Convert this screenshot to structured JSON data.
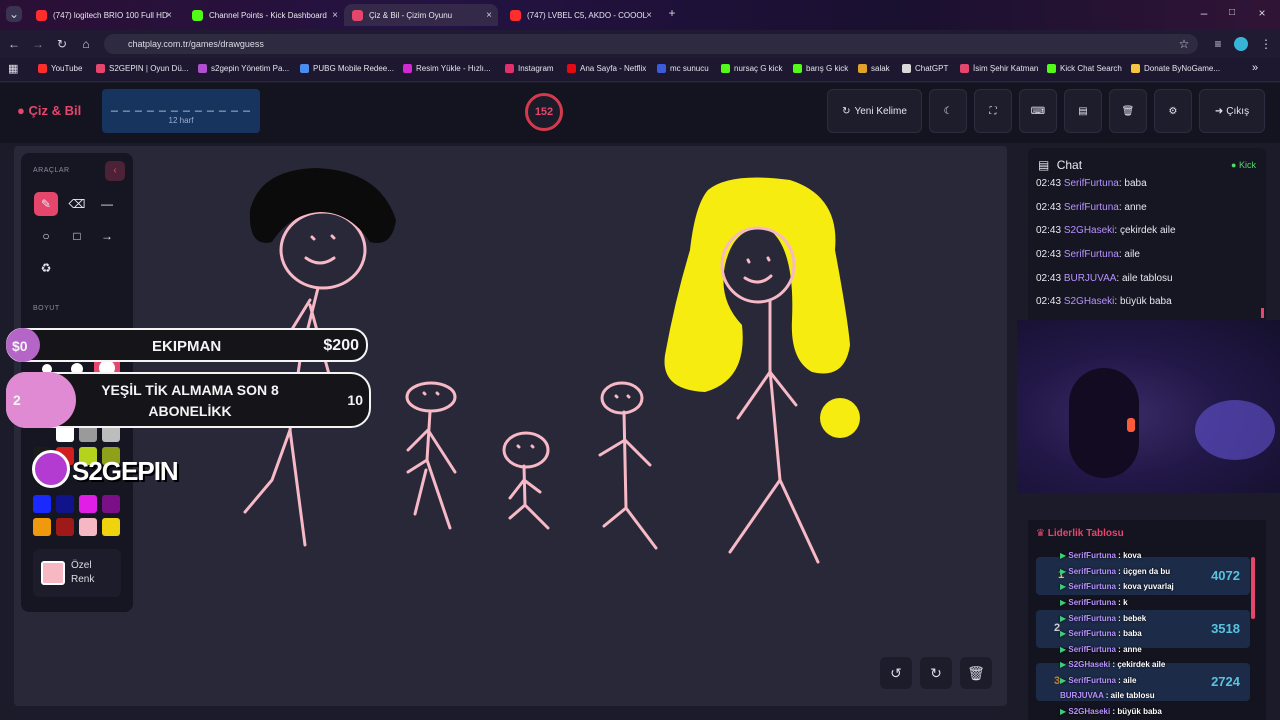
{
  "browser": {
    "tabs": [
      {
        "title": "(747) logitech BRIO 100 Full HD",
        "icon_color": "#ff2d2d"
      },
      {
        "title": "Channel Points - Kick Dashboard",
        "icon_color": "#53fc18"
      },
      {
        "title": "Çiz & Bil - Çizim Oyunu",
        "icon_color": "#e5466b"
      },
      {
        "title": "(747) LVBEL C5, AKDO - COOOL",
        "icon_color": "#ff2d2d"
      }
    ],
    "url": "chatplay.com.tr/games/drawguess",
    "bookmarks": [
      "YouTube",
      "S2GEPIN | Oyun Dü...",
      "s2gepin Yönetim Pa...",
      "PUBG Mobile Redee...",
      "Resim Yükle - Hızlı...",
      "Instagram",
      "Ana Sayfa - Netflix",
      "mc sunucu",
      "nursaç G kick",
      "barış G kick",
      "salak",
      "ChatGPT",
      "İsim Şehir Katman",
      "Kick Chat Search",
      "Donate ByNoGame..."
    ]
  },
  "header": {
    "logo": "Çiz & Bil",
    "word_mask": "_ _ _ _ _ _ _ _ _ _ _ _",
    "word_length": "12 harf",
    "timer": "152",
    "new_word": "Yeni Kelime",
    "logout": "Çıkış"
  },
  "tools": {
    "title": "ARAÇLAR",
    "size_title": "BOYUT",
    "custom_color_line1": "Özel",
    "custom_color_line2": "Renk",
    "custom_color": "#f7b7c3",
    "palette": [
      "#ffffff",
      "#9a9a9a",
      "#bdbdbd",
      "#1b1b1b",
      "#d11f1f",
      "#b5d21d",
      "#8fa01a",
      "#1a2aff",
      "#10138a",
      "#e11ee6",
      "#7a0f87",
      "#ef9a0c",
      "#a01919",
      "#f4b7c3",
      "#f0d30f"
    ]
  },
  "overlay": {
    "ekipman_left": "$0",
    "ekipman_label": "EKIPMAN",
    "ekipman_right": "$200",
    "goal_left": "2",
    "goal_label": "YEŞİL TİK ALMAMA SON 8 ABONELİKK",
    "goal_right": "10",
    "brand": "S2GEPIN"
  },
  "chat": {
    "title": "Chat",
    "status": "Kick",
    "messages": [
      {
        "time": "02:43",
        "user": "SerifFurtuna",
        "text": ": baba"
      },
      {
        "time": "02:43",
        "user": "SerifFurtuna",
        "text": ": anne"
      },
      {
        "time": "02:43",
        "user": "S2GHaseki",
        "text": ": çekirdek aile"
      },
      {
        "time": "02:43",
        "user": "SerifFurtuna",
        "text": ": aile"
      },
      {
        "time": "02:43",
        "user": "BURJUVAA",
        "text": ": aile tablosu"
      },
      {
        "time": "02:43",
        "user": "S2GHaseki",
        "text": ": büyük baba"
      }
    ]
  },
  "leaderboard": {
    "title": "Liderlik Tablosu",
    "rows": [
      {
        "rank": "1",
        "score": "4072"
      },
      {
        "rank": "2",
        "score": "3518"
      },
      {
        "rank": "3",
        "score": "2724"
      }
    ]
  },
  "stream_chat": [
    {
      "user": "SerifFurtuna",
      "text": " : kova"
    },
    {
      "user": "SerifFurtuna",
      "text": " : üçgen da bu"
    },
    {
      "user": "SerifFurtuna",
      "text": " : kova yuvarlaj"
    },
    {
      "user": "SerifFurtuna",
      "text": " : k"
    },
    {
      "user": "SerifFurtuna",
      "text": " : bebek"
    },
    {
      "user": "SerifFurtuna",
      "text": " : baba"
    },
    {
      "user": "SerifFurtuna",
      "text": " : anne"
    },
    {
      "user": "S2GHaseki",
      "text": " : çekirdek aile"
    },
    {
      "user": "SerifFurtuna",
      "text": " : aile"
    },
    {
      "user": "BURJUVAA",
      "text": " : aile tablosu"
    },
    {
      "user": "S2GHaseki",
      "text": " : büyük baba"
    }
  ]
}
